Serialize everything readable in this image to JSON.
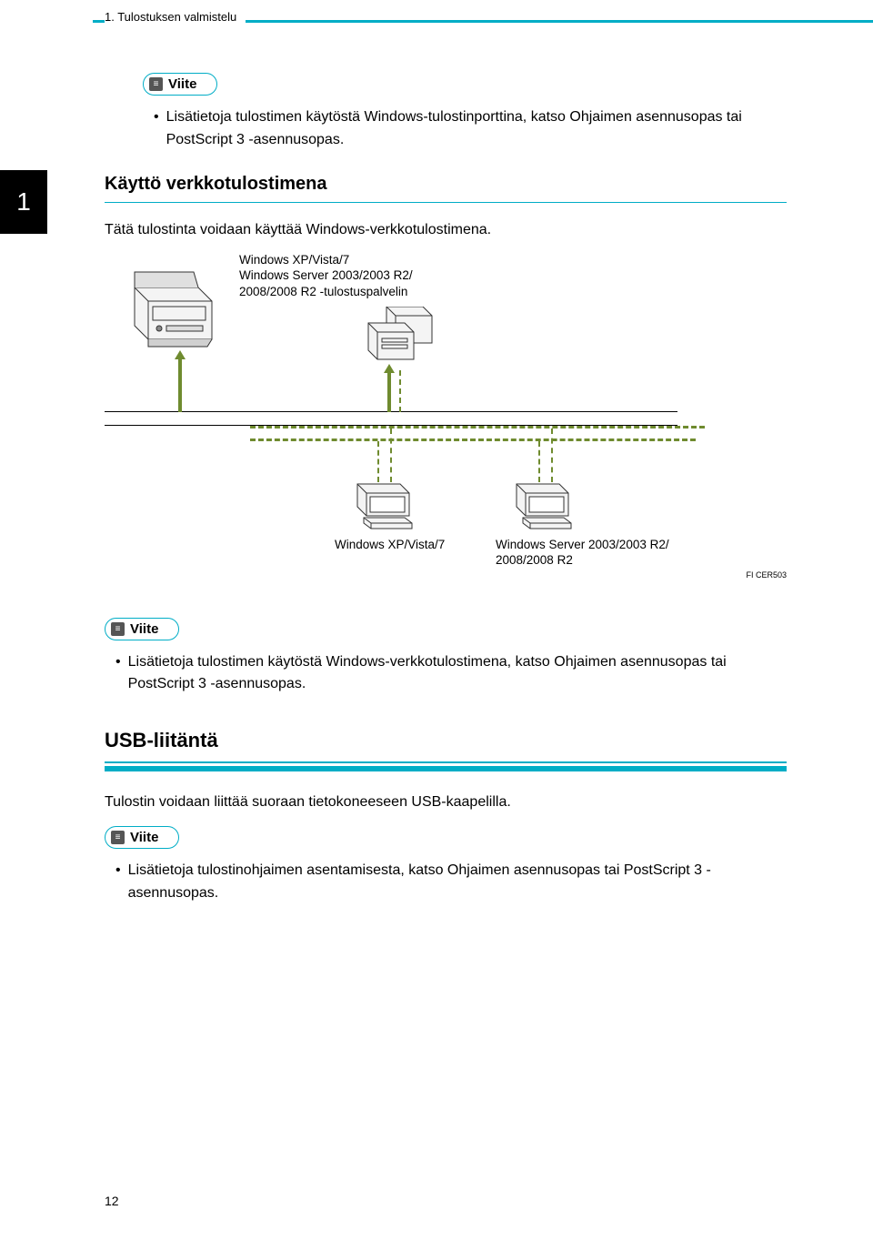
{
  "header": {
    "breadcrumb": "1. Tulostuksen valmistelu"
  },
  "side_tab": "1",
  "viite_label": "Viite",
  "section1": {
    "bullet1": "Lisätietoja tulostimen käytöstä Windows-tulostinporttina, katso Ohjaimen asennusopas tai PostScript 3 -asennusopas.",
    "h3": "Käyttö verkkotulostimena",
    "body": "Tätä tulostinta voidaan käyttää Windows-verkkotulostimena."
  },
  "diagram": {
    "top_label_line1": "Windows XP/Vista/7",
    "top_label_line2": "Windows Server 2003/2003 R2/",
    "top_label_line3": "2008/2008 R2 -tulostuspalvelin",
    "bottom_left": "Windows XP/Vista/7",
    "bottom_right_line1": "Windows Server 2003/2003 R2/",
    "bottom_right_line2": "2008/2008 R2",
    "code": "FI CER503"
  },
  "section2": {
    "bullet1": "Lisätietoja tulostimen käytöstä Windows-verkkotulostimena, katso Ohjaimen asennusopas tai PostScript 3 -asennusopas."
  },
  "section3": {
    "h2": "USB-liitäntä",
    "body": "Tulostin voidaan liittää suoraan tietokoneeseen USB-kaapelilla.",
    "bullet1": "Lisätietoja tulostinohjaimen asentamisesta, katso Ohjaimen asennusopas tai PostScript 3 -asennusopas."
  },
  "page_number": "12"
}
